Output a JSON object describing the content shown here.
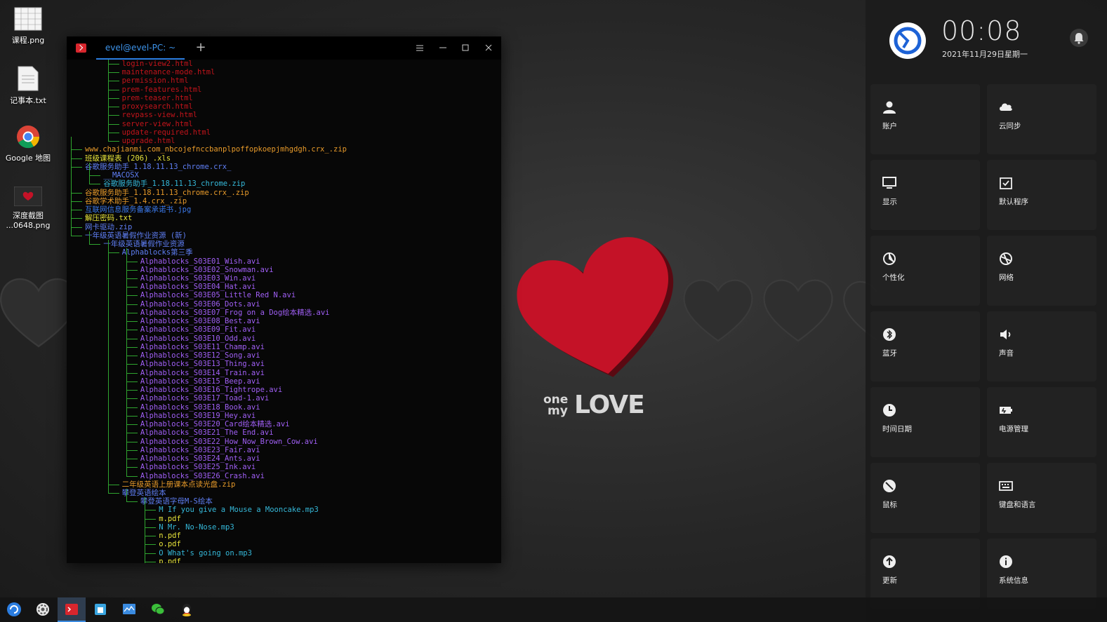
{
  "desktop": {
    "icons": [
      {
        "name": "课程.png"
      },
      {
        "name": "记事本.txt"
      },
      {
        "name": "Google 地图"
      },
      {
        "name": "深度截图\n...0648.png"
      }
    ],
    "wallpaper": {
      "logo_one": "one",
      "logo_my": "my",
      "logo_love": "LOVE"
    }
  },
  "terminal": {
    "tab_title": "evel@evel-PC: ~",
    "add_tab": "+",
    "lines": [
      {
        "text": "login-view2.html",
        "color": "#c3141b",
        "indent": 3,
        "branch": "mid"
      },
      {
        "text": "maintenance-mode.html",
        "color": "#c3141b",
        "indent": 3,
        "branch": "mid"
      },
      {
        "text": "permission.html",
        "color": "#c3141b",
        "indent": 3,
        "branch": "mid"
      },
      {
        "text": "prem-features.html",
        "color": "#c3141b",
        "indent": 3,
        "branch": "mid"
      },
      {
        "text": "prem-teaser.html",
        "color": "#c3141b",
        "indent": 3,
        "branch": "mid"
      },
      {
        "text": "proxysearch.html",
        "color": "#c3141b",
        "indent": 3,
        "branch": "mid"
      },
      {
        "text": "revpass-view.html",
        "color": "#c3141b",
        "indent": 3,
        "branch": "mid"
      },
      {
        "text": "server-view.html",
        "color": "#c3141b",
        "indent": 3,
        "branch": "mid"
      },
      {
        "text": "update-required.html",
        "color": "#c3141b",
        "indent": 3,
        "branch": "mid"
      },
      {
        "text": "upgrade.html",
        "color": "#c3141b",
        "indent": 3,
        "branch": "end"
      },
      {
        "text": "www.chajianmi.com_nbcojefnccbanplpoffopkoepjmhgdgh.crx_.zip",
        "color": "#e79a2a",
        "indent": 1,
        "branch": "mid"
      },
      {
        "text": "班级课程表 (206) .xls",
        "color": "#e6e33a",
        "indent": 1,
        "branch": "mid"
      },
      {
        "text": "谷歌服务助手_1.18.11.13_chrome.crx_",
        "color": "#5f7ff5",
        "indent": 1,
        "branch": "mid"
      },
      {
        "text": "__MACOSX",
        "color": "#5f7ff5",
        "indent": 2,
        "branch": "mid"
      },
      {
        "text": "谷歌服务助手_1.18.11.13_chrome.zip",
        "color": "#35b8d9",
        "indent": 2,
        "branch": "end"
      },
      {
        "text": "谷歌服务助手_1.18.11.13_chrome.crx_.zip",
        "color": "#e79a2a",
        "indent": 1,
        "branch": "mid"
      },
      {
        "text": "谷歌学术助手_1.4.crx_.zip",
        "color": "#e79a2a",
        "indent": 1,
        "branch": "mid"
      },
      {
        "text": "互联网信息服务备案承诺书.jpg",
        "color": "#3a78e8",
        "indent": 1,
        "branch": "mid"
      },
      {
        "text": "解压密码.txt",
        "color": "#e6e33a",
        "indent": 1,
        "branch": "mid"
      },
      {
        "text": "网卡驱动.zip",
        "color": "#5f7ff5",
        "indent": 1,
        "branch": "mid"
      },
      {
        "text": "一年级英语暑假作业资源 (新)",
        "color": "#5f7ff5",
        "indent": 1,
        "branch": "end"
      },
      {
        "text": "一年级英语暑假作业资源",
        "color": "#5f7ff5",
        "indent": 2,
        "branch": "end"
      },
      {
        "text": "Alphablocks第三季",
        "color": "#5f7ff5",
        "indent": 3,
        "branch": "mid"
      },
      {
        "text": "Alphablocks_S03E01_Wish.avi",
        "color": "#a05ff5",
        "indent": 4,
        "branch": "mid"
      },
      {
        "text": "Alphablocks_S03E02_Snowman.avi",
        "color": "#a05ff5",
        "indent": 4,
        "branch": "mid"
      },
      {
        "text": "Alphablocks_S03E03_Win.avi",
        "color": "#a05ff5",
        "indent": 4,
        "branch": "mid"
      },
      {
        "text": "Alphablocks_S03E04_Hat.avi",
        "color": "#a05ff5",
        "indent": 4,
        "branch": "mid"
      },
      {
        "text": "Alphablocks_S03E05_Little Red N.avi",
        "color": "#a05ff5",
        "indent": 4,
        "branch": "mid"
      },
      {
        "text": "Alphablocks_S03E06_Dots.avi",
        "color": "#a05ff5",
        "indent": 4,
        "branch": "mid"
      },
      {
        "text": "Alphablocks_S03E07_Frog on a Dog绘本精选.avi",
        "color": "#a05ff5",
        "indent": 4,
        "branch": "mid"
      },
      {
        "text": "Alphablocks_S03E08_Best.avi",
        "color": "#a05ff5",
        "indent": 4,
        "branch": "mid"
      },
      {
        "text": "Alphablocks_S03E09_Fit.avi",
        "color": "#a05ff5",
        "indent": 4,
        "branch": "mid"
      },
      {
        "text": "Alphablocks_S03E10_Odd.avi",
        "color": "#a05ff5",
        "indent": 4,
        "branch": "mid"
      },
      {
        "text": "Alphablocks_S03E11_Champ.avi",
        "color": "#a05ff5",
        "indent": 4,
        "branch": "mid"
      },
      {
        "text": "Alphablocks_S03E12_Song.avi",
        "color": "#a05ff5",
        "indent": 4,
        "branch": "mid"
      },
      {
        "text": "Alphablocks_S03E13_Thing.avi",
        "color": "#a05ff5",
        "indent": 4,
        "branch": "mid"
      },
      {
        "text": "Alphablocks_S03E14_Train.avi",
        "color": "#a05ff5",
        "indent": 4,
        "branch": "mid"
      },
      {
        "text": "Alphablocks_S03E15_Beep.avi",
        "color": "#a05ff5",
        "indent": 4,
        "branch": "mid"
      },
      {
        "text": "Alphablocks_S03E16_Tightrope.avi",
        "color": "#a05ff5",
        "indent": 4,
        "branch": "mid"
      },
      {
        "text": "Alphablocks_S03E17_Toad-1.avi",
        "color": "#a05ff5",
        "indent": 4,
        "branch": "mid"
      },
      {
        "text": "Alphablocks_S03E18_Book.avi",
        "color": "#a05ff5",
        "indent": 4,
        "branch": "mid"
      },
      {
        "text": "Alphablocks_S03E19_Hey.avi",
        "color": "#a05ff5",
        "indent": 4,
        "branch": "mid"
      },
      {
        "text": "Alphablocks_S03E20_Card绘本精选.avi",
        "color": "#a05ff5",
        "indent": 4,
        "branch": "mid"
      },
      {
        "text": "Alphablocks_S03E21_The End.avi",
        "color": "#a05ff5",
        "indent": 4,
        "branch": "mid"
      },
      {
        "text": "Alphablocks_S03E22_How_Now_Brown_Cow.avi",
        "color": "#a05ff5",
        "indent": 4,
        "branch": "mid"
      },
      {
        "text": "Alphablocks_S03E23_Fair.avi",
        "color": "#a05ff5",
        "indent": 4,
        "branch": "mid"
      },
      {
        "text": "Alphablocks_S03E24_Ants.avi",
        "color": "#a05ff5",
        "indent": 4,
        "branch": "mid"
      },
      {
        "text": "Alphablocks_S03E25_Ink.avi",
        "color": "#a05ff5",
        "indent": 4,
        "branch": "mid"
      },
      {
        "text": "Alphablocks_S03E26_Crash.avi",
        "color": "#a05ff5",
        "indent": 4,
        "branch": "end"
      },
      {
        "text": "二年级英语上册课本点读光盘.zip",
        "color": "#e79a2a",
        "indent": 3,
        "branch": "mid"
      },
      {
        "text": "攀登英语绘本",
        "color": "#5f7ff5",
        "indent": 3,
        "branch": "end"
      },
      {
        "text": "攀登英语字母M-S绘本",
        "color": "#5f7ff5",
        "indent": 4,
        "branch": "end"
      },
      {
        "text": "M If you give a Mouse a Mooncake.mp3",
        "color": "#35b8d9",
        "indent": 5,
        "branch": "mid"
      },
      {
        "text": "m.pdf",
        "color": "#e6e33a",
        "indent": 5,
        "branch": "mid"
      },
      {
        "text": "N Mr. No-Nose.mp3",
        "color": "#35b8d9",
        "indent": 5,
        "branch": "mid"
      },
      {
        "text": "n.pdf",
        "color": "#e6e33a",
        "indent": 5,
        "branch": "mid"
      },
      {
        "text": "o.pdf",
        "color": "#e6e33a",
        "indent": 5,
        "branch": "mid"
      },
      {
        "text": "O What's going on.mp3",
        "color": "#35b8d9",
        "indent": 5,
        "branch": "mid"
      },
      {
        "text": "p.pdf",
        "color": "#e6e33a",
        "indent": 5,
        "branch": "mid"
      }
    ]
  },
  "control_center": {
    "time": "00:08",
    "date": "2021年11月29日星期一",
    "tiles": [
      {
        "label": "账户",
        "icon": "user-icon"
      },
      {
        "label": "云同步",
        "icon": "cloud-icon"
      },
      {
        "label": "显示",
        "icon": "monitor-icon"
      },
      {
        "label": "默认程序",
        "icon": "default-app-icon"
      },
      {
        "label": "个性化",
        "icon": "palette-icon"
      },
      {
        "label": "网络",
        "icon": "network-icon"
      },
      {
        "label": "蓝牙",
        "icon": "bluetooth-icon"
      },
      {
        "label": "声音",
        "icon": "speaker-icon"
      },
      {
        "label": "时间日期",
        "icon": "clock-icon"
      },
      {
        "label": "电源管理",
        "icon": "battery-icon"
      },
      {
        "label": "鼠标",
        "icon": "mouse-icon"
      },
      {
        "label": "键盘和语言",
        "icon": "keyboard-icon"
      },
      {
        "label": "更新",
        "icon": "update-icon"
      },
      {
        "label": "系统信息",
        "icon": "info-icon"
      }
    ]
  },
  "taskbar": {
    "apps": [
      "launcher-icon",
      "settings-icon",
      "terminal-icon",
      "store-icon",
      "monitor-app-icon",
      "wechat-icon",
      "qq-icon"
    ]
  },
  "colors": {
    "accent": "#2b7de0",
    "heart": "#c41227",
    "tree_line": "#2fa52f"
  }
}
